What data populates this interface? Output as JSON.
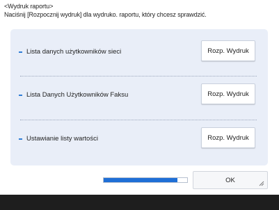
{
  "header": {
    "title": "<Wydruk raportu>",
    "instruction": "Naciśnij [Rozpocznij wydruk] dla wydruko. raportu, który chcesz sprawdzić."
  },
  "reports": [
    {
      "label": "Lista danych użytkowników sieci",
      "button": "Rozp. Wydruk"
    },
    {
      "label": "Lista Danych Użytkowników Faksu",
      "button": "Rozp. Wydruk"
    },
    {
      "label": "Ustawianie listy wartości",
      "button": "Rozp. Wydruk"
    }
  ],
  "progress": {
    "value": 0.88
  },
  "footer": {
    "ok_label": "OK"
  },
  "colors": {
    "accent": "#1f6fd6",
    "panel": "#e9eef8",
    "bar": "#1e1e1e"
  }
}
